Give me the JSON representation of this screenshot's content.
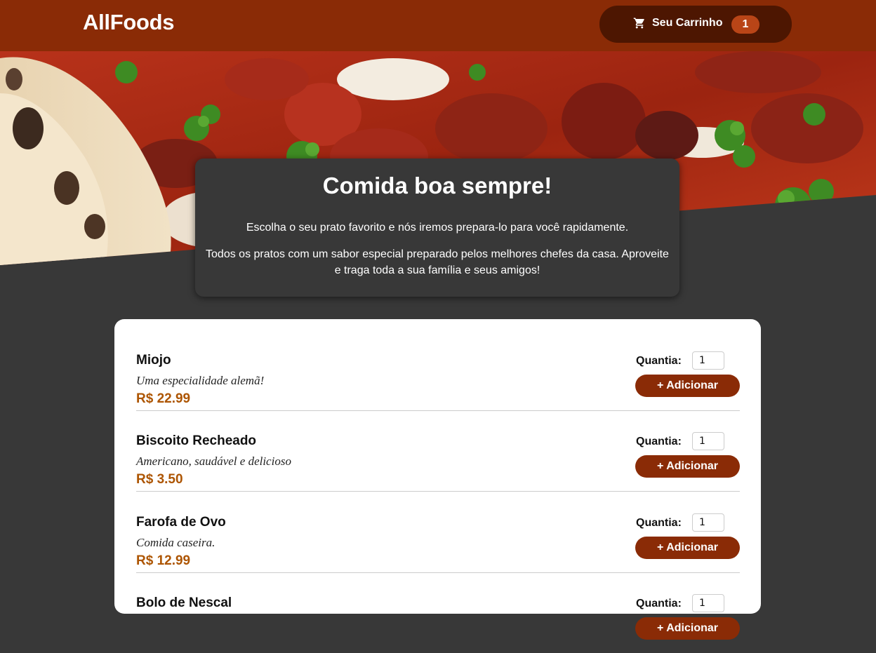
{
  "header": {
    "logo": "AllFoods",
    "cart": {
      "icon": "cart-icon",
      "label": "Seu Carrinho",
      "count": "1"
    }
  },
  "hero": {
    "image": "pizza-photo"
  },
  "summary": {
    "title": "Comida boa sempre!",
    "paragraph1": "Escolha o seu prato favorito e nós iremos prepara-lo para você rapidamente.",
    "paragraph2": "Todos os pratos com um sabor especial preparado pelos melhores chefes da casa. Aproveite e traga toda a sua família e seus amigos!"
  },
  "meals": {
    "qty_label": "Quantia:",
    "add_label": "+ Adicionar",
    "items": [
      {
        "name": "Miojo",
        "description": "Uma especialidade alemã!",
        "price": "R$ 22.99",
        "qty": "1"
      },
      {
        "name": "Biscoito Recheado",
        "description": "Americano, saudável e delicioso",
        "price": "R$ 3.50",
        "qty": "1"
      },
      {
        "name": "Farofa de Ovo",
        "description": "Comida caseira.",
        "price": "R$ 12.99",
        "qty": "1"
      },
      {
        "name": "Bolo de Nescal",
        "description": "",
        "price": "",
        "qty": "1"
      }
    ]
  },
  "colors": {
    "header_bg": "#8a2b06",
    "cart_bg": "#4d1601",
    "badge_bg": "#b94517",
    "page_bg": "#383838",
    "price": "#ad5502",
    "button_bg": "#8a2b06"
  }
}
